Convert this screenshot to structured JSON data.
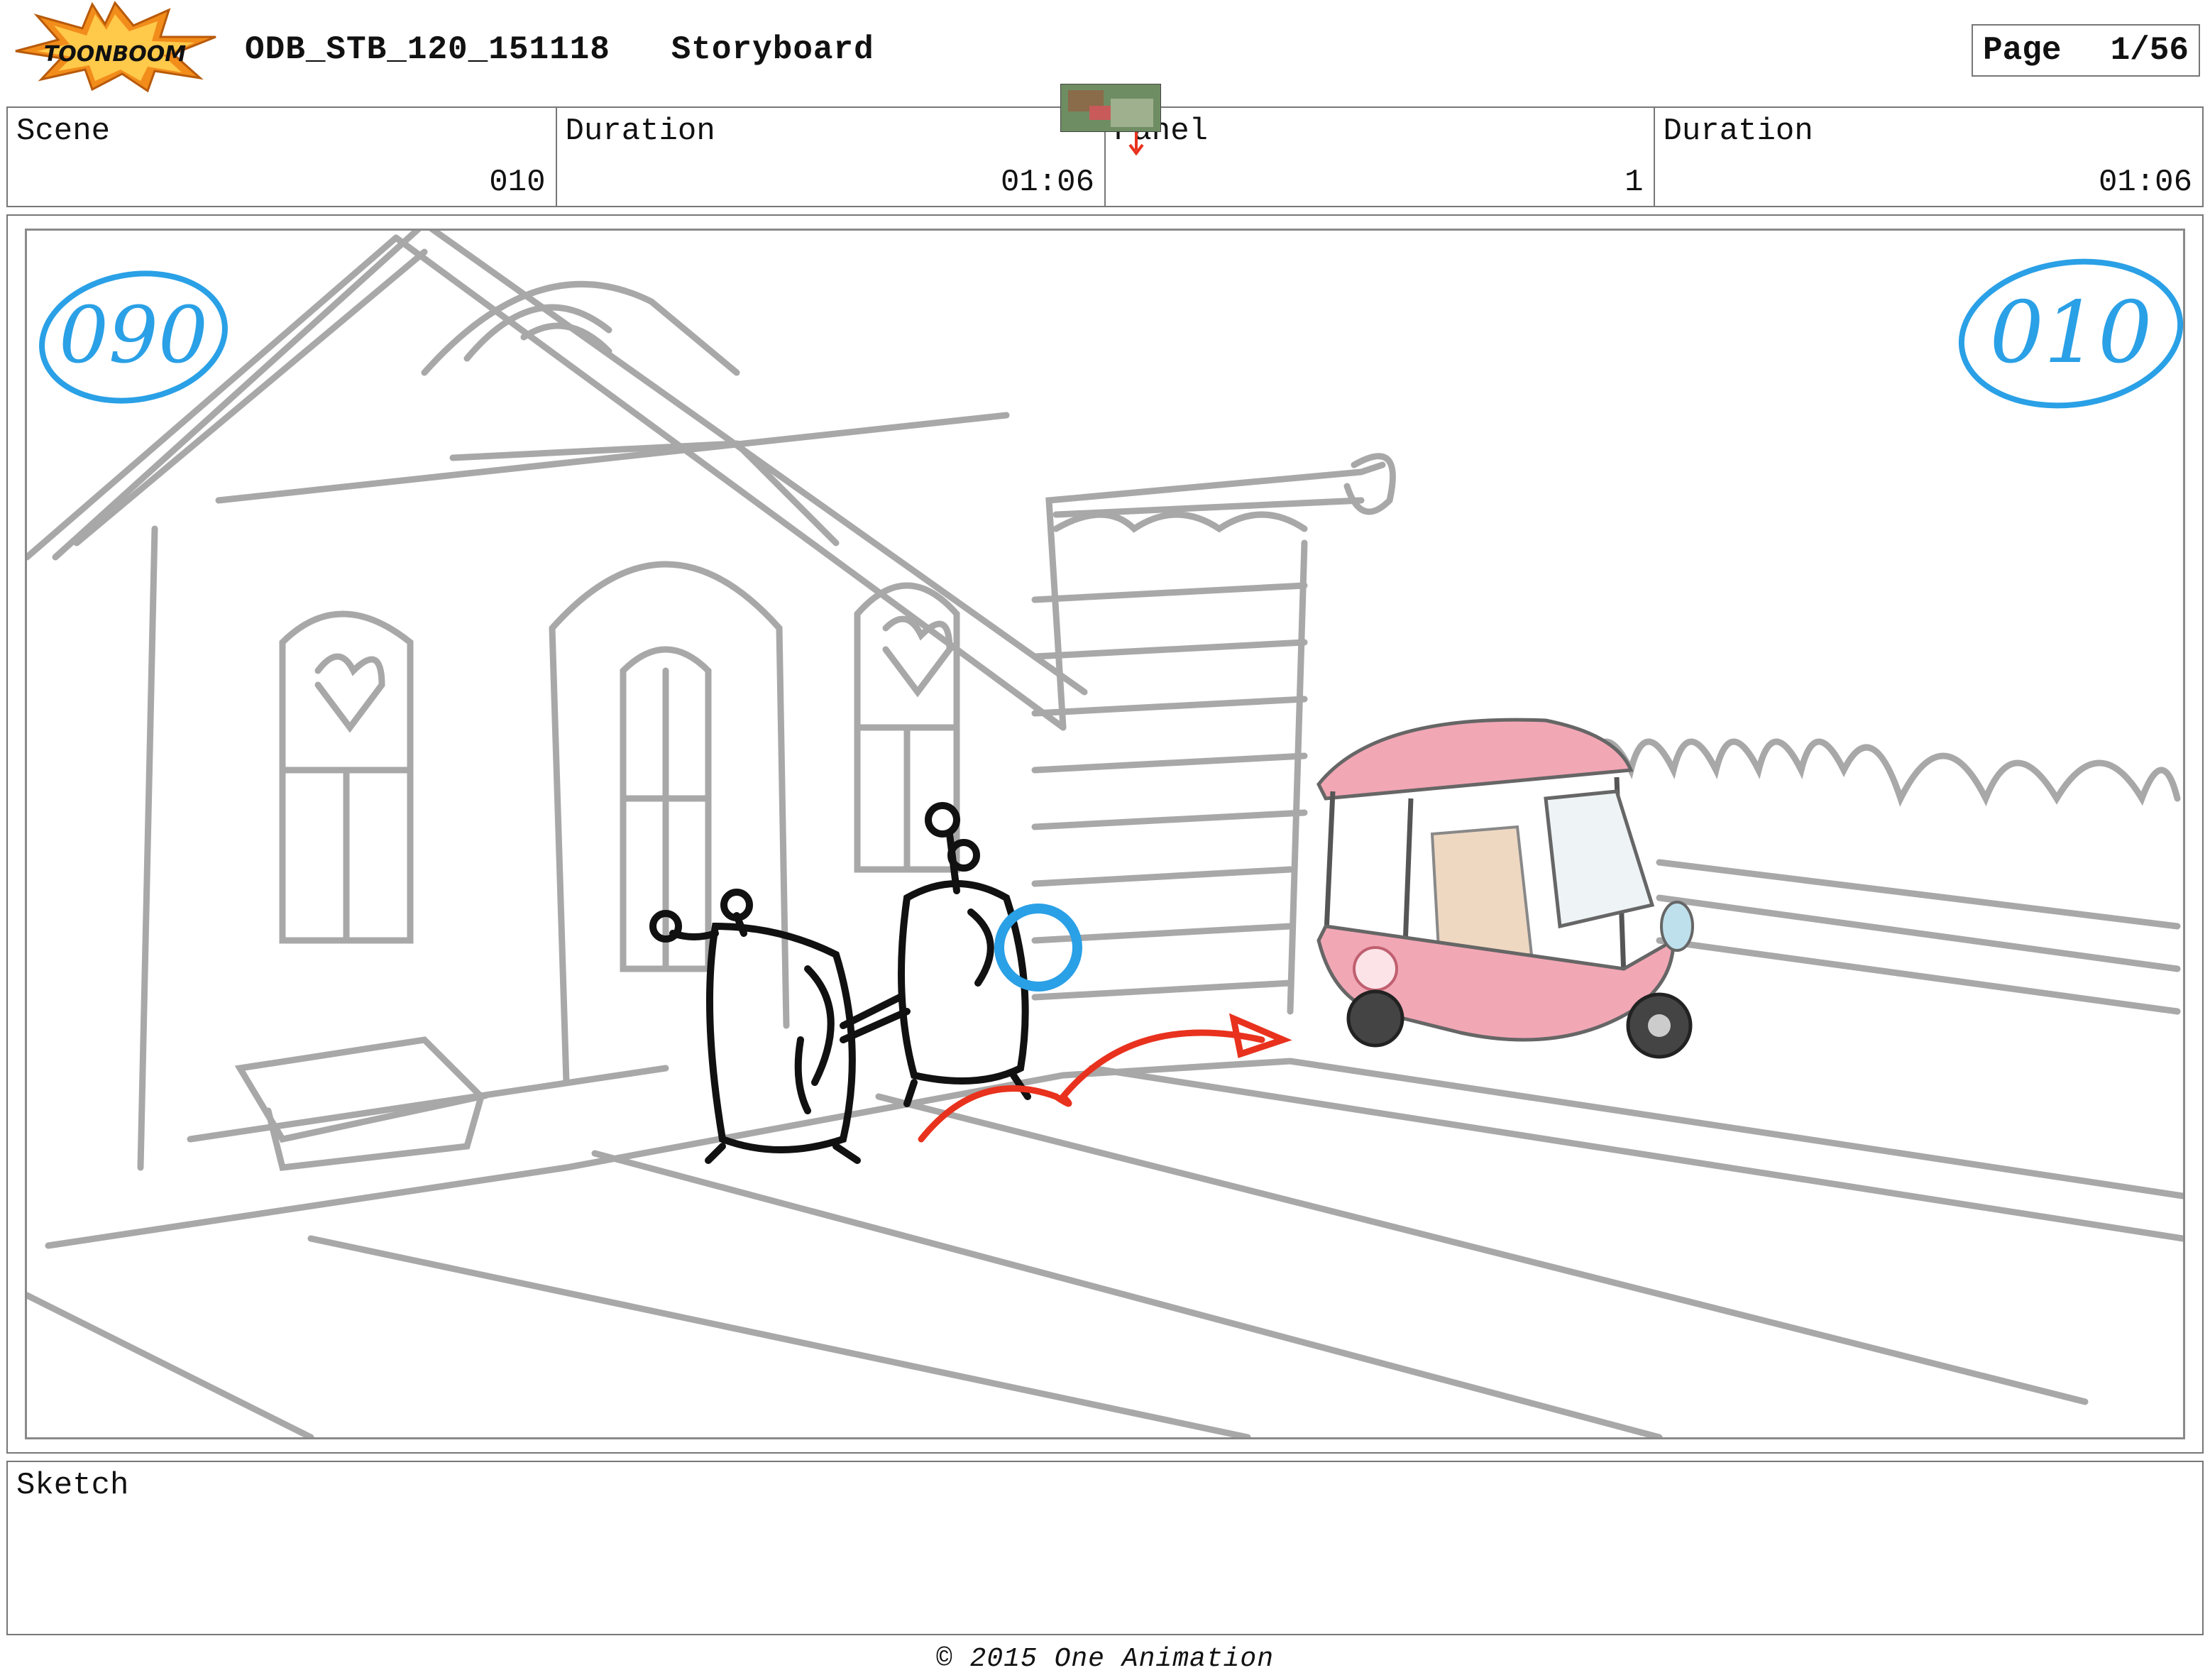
{
  "header": {
    "logo_text": "TOONBOOM",
    "title": "ODB_STB_120_151118   Storyboard",
    "page_label": "Page",
    "page_value": "1/56"
  },
  "info": {
    "scene_label": "Scene",
    "scene_value": "010",
    "scene_duration_label": "Duration",
    "scene_duration_value": "01:06",
    "panel_label": "Panel",
    "panel_value": "1",
    "panel_duration_label": "Duration",
    "panel_duration_value": "01:06"
  },
  "panel": {
    "annotation_left": "090",
    "annotation_right": "010"
  },
  "sketch": {
    "label": "Sketch"
  },
  "footer": {
    "copyright": "© 2015 One Animation"
  },
  "colors": {
    "sketch_gray": "#a8a8a8",
    "annotation_blue": "#2aa0e6",
    "action_red": "#e8321e",
    "vehicle_pink": "#f2a7b5",
    "logo_orange": "#f28c1a"
  }
}
